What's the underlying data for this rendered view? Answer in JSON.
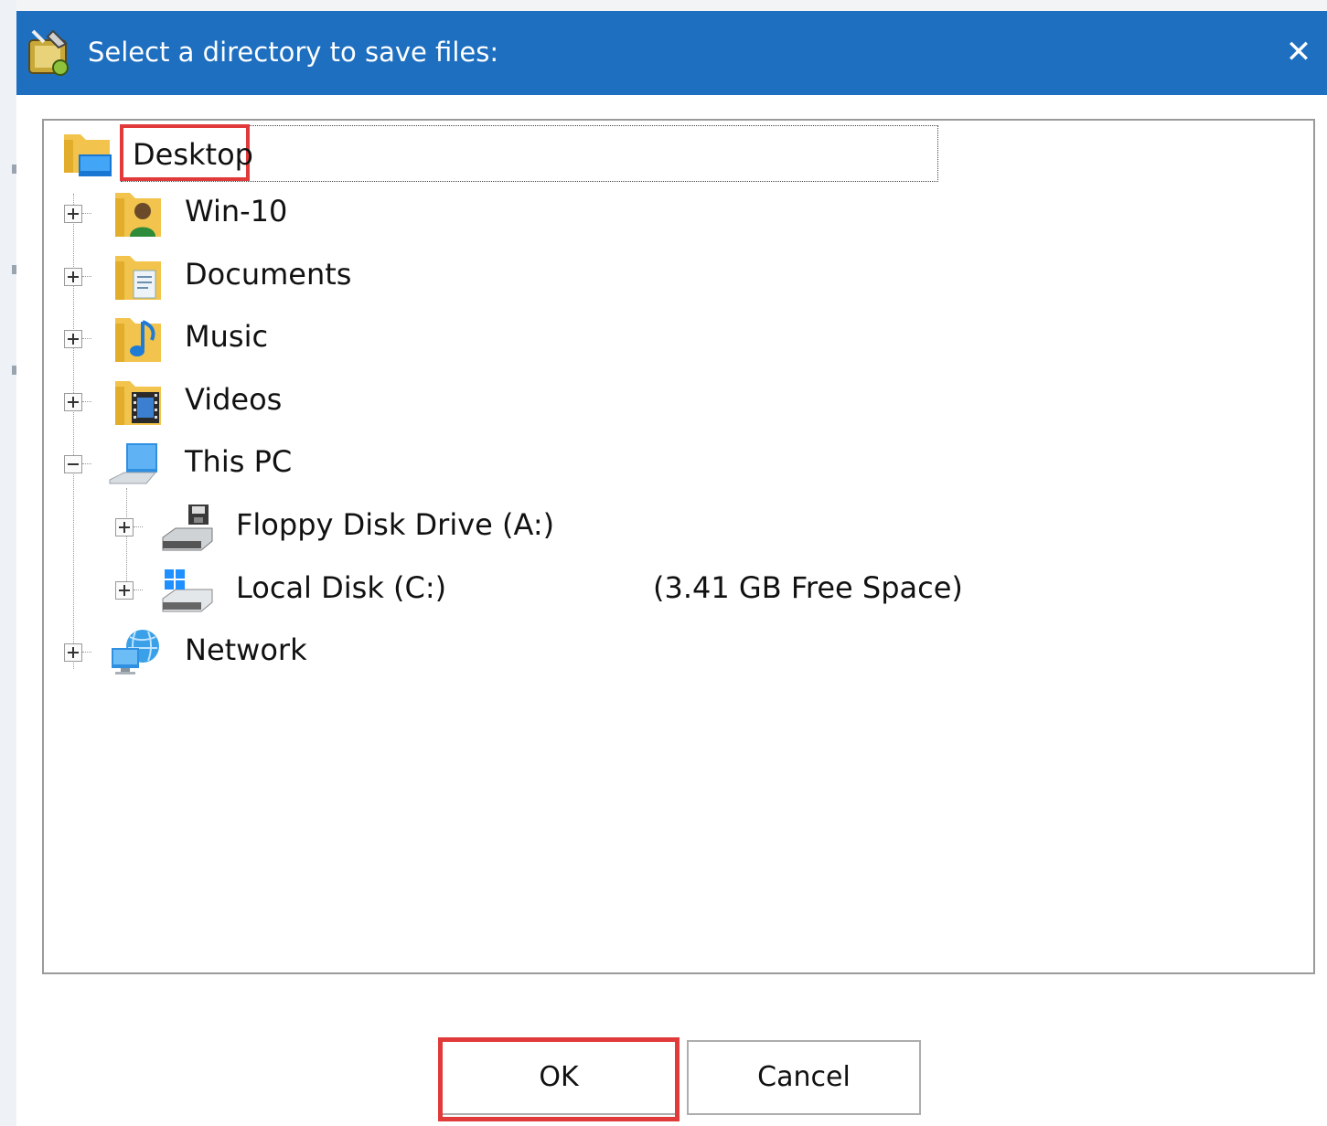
{
  "dialog": {
    "title": "Select a directory to save files:",
    "close_glyph": "✕"
  },
  "tree": {
    "root": {
      "label": "Desktop",
      "icon": "desktop-folder-icon"
    },
    "items": [
      {
        "label": "Win-10",
        "icon": "user-folder-icon",
        "expanded": false
      },
      {
        "label": "Documents",
        "icon": "documents-folder-icon",
        "expanded": false
      },
      {
        "label": "Music",
        "icon": "music-folder-icon",
        "expanded": false
      },
      {
        "label": "Videos",
        "icon": "videos-folder-icon",
        "expanded": false
      },
      {
        "label": "This PC",
        "icon": "computer-icon",
        "expanded": true,
        "children": [
          {
            "label": "Floppy Disk Drive (A:)",
            "icon": "floppy-drive-icon"
          },
          {
            "label": "Local Disk (C:)",
            "icon": "local-disk-icon",
            "free_space": "(3.41 GB Free Space)"
          }
        ]
      },
      {
        "label": "Network",
        "icon": "network-icon",
        "expanded": false
      }
    ]
  },
  "buttons": {
    "ok": "OK",
    "cancel": "Cancel"
  },
  "colors": {
    "titlebar": "#1e6fc0",
    "highlight": "#e03a3a"
  }
}
